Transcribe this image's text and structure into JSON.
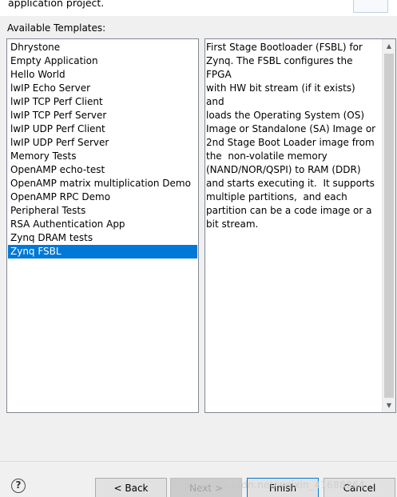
{
  "header": {
    "description": "application project."
  },
  "templates": {
    "label": "Available Templates:",
    "items": [
      "Dhrystone",
      "Empty Application",
      "Hello World",
      "lwIP Echo Server",
      "lwIP TCP Perf Client",
      "lwIP TCP Perf Server",
      "lwIP UDP Perf Client",
      "lwIP UDP Perf Server",
      "Memory Tests",
      "OpenAMP echo-test",
      "OpenAMP matrix multiplication Demo",
      "OpenAMP RPC Demo",
      "Peripheral Tests",
      "RSA Authentication App",
      "Zynq DRAM tests",
      "Zynq FSBL"
    ],
    "selected": "Zynq FSBL"
  },
  "description": {
    "text": "First Stage Bootloader (FSBL) for\nZynq. The FSBL configures the FPGA\nwith HW bit stream (if it exists)  and\nloads the Operating System (OS)\nImage or Standalone (SA) Image or\n2nd Stage Boot Loader image from\nthe  non-volatile memory\n(NAND/NOR/QSPI) to RAM (DDR)\nand starts executing it.  It supports\nmultiple partitions,  and each\npartition can be a code image or a\nbit stream."
  },
  "buttons": {
    "help": "?",
    "back": "< Back",
    "next": "Next >",
    "finish": "Finish",
    "cancel": "Cancel"
  },
  "watermark": "https://blog.csdn.net/weixin_41688864",
  "colors": {
    "selection": "#0078d7",
    "dialog_bg": "#f0f0f0"
  }
}
